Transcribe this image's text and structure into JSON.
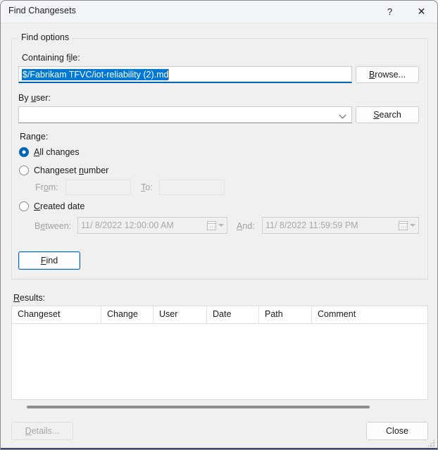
{
  "window": {
    "title": "Find Changesets",
    "help_icon": "question-mark-icon",
    "close_icon": "close-icon"
  },
  "find_options": {
    "group_label": "Find options",
    "containing_file": {
      "label": "Containing file:",
      "label_accel": "i",
      "value": "$/Fabrikam TFVC/iot-reliability (2).md",
      "selected": true,
      "browse_button": "Browse...",
      "browse_accel": "B"
    },
    "by_user": {
      "label": "By user:",
      "label_accel": "u",
      "value": "",
      "search_button": "Search",
      "search_accel": "S"
    },
    "range": {
      "label": "Range:",
      "options": [
        {
          "label": "All changes",
          "accel": "A",
          "selected": true
        },
        {
          "label": "Changeset number",
          "accel": "n",
          "selected": false
        },
        {
          "label": "Created date",
          "accel": "C",
          "selected": false
        }
      ],
      "changeset_number": {
        "from_label": "From:",
        "from_accel": "o",
        "from_value": "",
        "to_label": "To:",
        "to_accel": "T",
        "to_value": "",
        "enabled": false
      },
      "created_date": {
        "between_label": "Between:",
        "between_accel": "e",
        "between_value": "11/  8/2022 12:00:00 AM",
        "and_label": "And:",
        "and_accel": "A",
        "and_value": "11/  8/2022 11:59:59 PM",
        "enabled": false,
        "picker_icon": "calendar-icon",
        "picker_arrow_icon": "chevron-down-icon"
      }
    },
    "find_button": "Find",
    "find_accel": "F"
  },
  "results": {
    "label": "Results:",
    "label_accel": "R",
    "columns": [
      "Changeset",
      "Change",
      "User",
      "Date",
      "Path",
      "Comment"
    ],
    "rows": []
  },
  "footer": {
    "details_button": "Details...",
    "details_accel": "D",
    "details_enabled": false,
    "close_button": "Close",
    "close_enabled": true
  },
  "colors": {
    "accent": "#0078d4",
    "focus_border": "#0067b8",
    "selection_bg": "#0078d4",
    "dialog_bg": "#f0f0f0",
    "titlebar_bg": "#f3f6f9",
    "disabled_text": "#a0a0a0"
  }
}
